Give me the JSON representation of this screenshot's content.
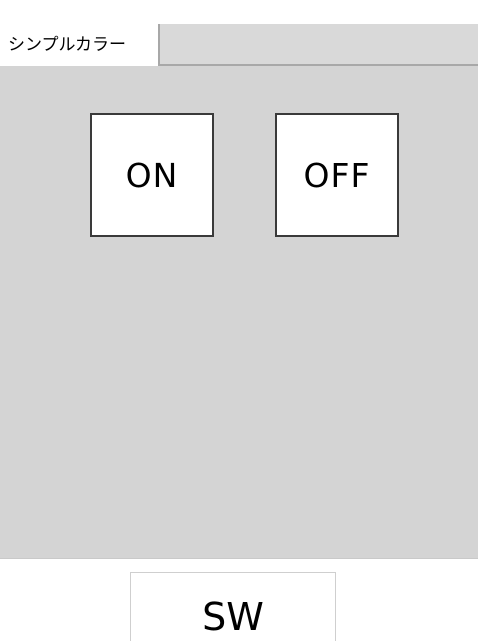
{
  "tabs": {
    "active_label": "シンプルカラー"
  },
  "panel": {
    "buttons": {
      "on_label": "ON",
      "off_label": "OFF"
    }
  },
  "footer": {
    "title": "SW"
  },
  "colors": {
    "panel_background": "#d4d4d4",
    "tab_inactive_background": "#d9d9d9",
    "button_background": "#ffffff",
    "button_border": "#3a3a3a"
  }
}
